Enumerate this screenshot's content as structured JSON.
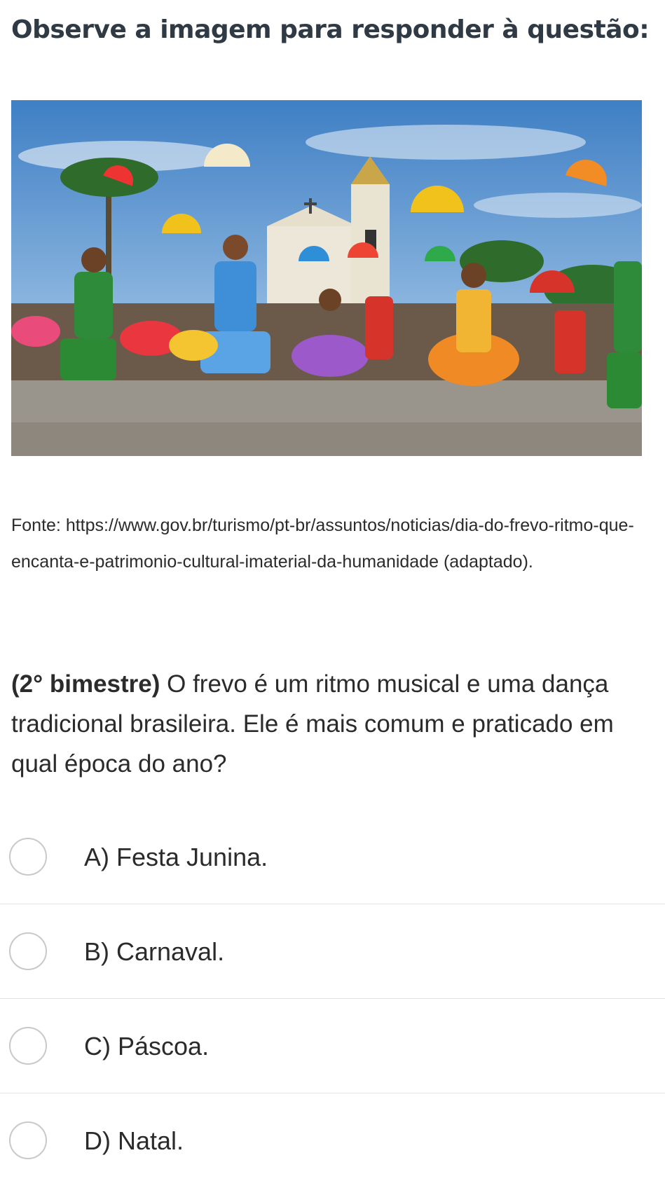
{
  "heading": "Observe a imagem para responder à questão:",
  "image": {
    "description_icon": "frevo-dancers-photo",
    "colors": {
      "sky": "#4f89c9",
      "ground": "#9a958c",
      "church": "#ece7d8"
    }
  },
  "source_text": "Fonte: https://www.gov.br/turismo/pt-br/assuntos/noticias/dia-do-frevo-ritmo-que-encanta-e-patrimonio-cultural-imaterial-da-humanidade (adaptado).",
  "question": {
    "tag": "(2° bimestre)",
    "text": " O frevo é um ritmo musical e uma dança tradicional brasileira. Ele é mais comum e praticado em qual época do ano?"
  },
  "options": [
    {
      "label": "A) Festa Junina."
    },
    {
      "label": "B) Carnaval."
    },
    {
      "label": "C) Páscoa."
    },
    {
      "label": "D) Natal."
    }
  ]
}
